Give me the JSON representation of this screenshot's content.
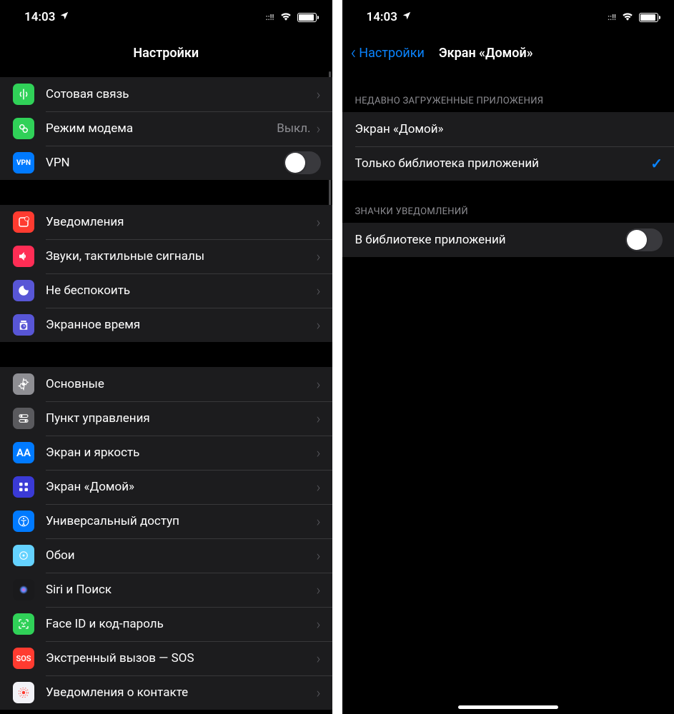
{
  "status": {
    "time": "14:03"
  },
  "left": {
    "title": "Настройки",
    "groups": [
      {
        "rows": [
          {
            "id": "cellular",
            "label": "Сотовая связь",
            "chevron": true
          },
          {
            "id": "hotspot",
            "label": "Режим модема",
            "detail": "Выкл.",
            "chevron": true
          },
          {
            "id": "vpn",
            "label": "VPN",
            "toggle": true,
            "toggle_on": false
          }
        ]
      },
      {
        "rows": [
          {
            "id": "notifications",
            "label": "Уведомления",
            "chevron": true
          },
          {
            "id": "sounds",
            "label": "Звуки, тактильные сигналы",
            "chevron": true
          },
          {
            "id": "dnd",
            "label": "Не беспокоить",
            "chevron": true
          },
          {
            "id": "screentime",
            "label": "Экранное время",
            "chevron": true
          }
        ]
      },
      {
        "rows": [
          {
            "id": "general",
            "label": "Основные",
            "chevron": true
          },
          {
            "id": "controlcenter",
            "label": "Пункт управления",
            "chevron": true
          },
          {
            "id": "display",
            "label": "Экран и яркость",
            "chevron": true
          },
          {
            "id": "homescreen",
            "label": "Экран «Домой»",
            "chevron": true
          },
          {
            "id": "accessibility",
            "label": "Универсальный доступ",
            "chevron": true
          },
          {
            "id": "wallpaper",
            "label": "Обои",
            "chevron": true
          },
          {
            "id": "siri",
            "label": "Siri и Поиск",
            "chevron": true
          },
          {
            "id": "faceid",
            "label": "Face ID и код-пароль",
            "chevron": true
          },
          {
            "id": "sos",
            "label": "Экстренный вызов — SOS",
            "chevron": true
          },
          {
            "id": "exposure",
            "label": "Уведомления о контакте",
            "chevron": true
          }
        ]
      }
    ]
  },
  "right": {
    "back": "Настройки",
    "title": "Экран «Домой»",
    "sections": [
      {
        "header": "НЕДАВНО ЗАГРУЖЕННЫЕ ПРИЛОЖЕНИЯ",
        "rows": [
          {
            "id": "opt-home",
            "label": "Экран «Домой»",
            "checked": false
          },
          {
            "id": "opt-library",
            "label": "Только библиотека приложений",
            "checked": true
          }
        ]
      },
      {
        "header": "ЗНАЧКИ УВЕДОМЛЕНИЙ",
        "rows": [
          {
            "id": "badges-library",
            "label": "В библиотеке приложений",
            "toggle": true,
            "toggle_on": false
          }
        ]
      }
    ]
  }
}
